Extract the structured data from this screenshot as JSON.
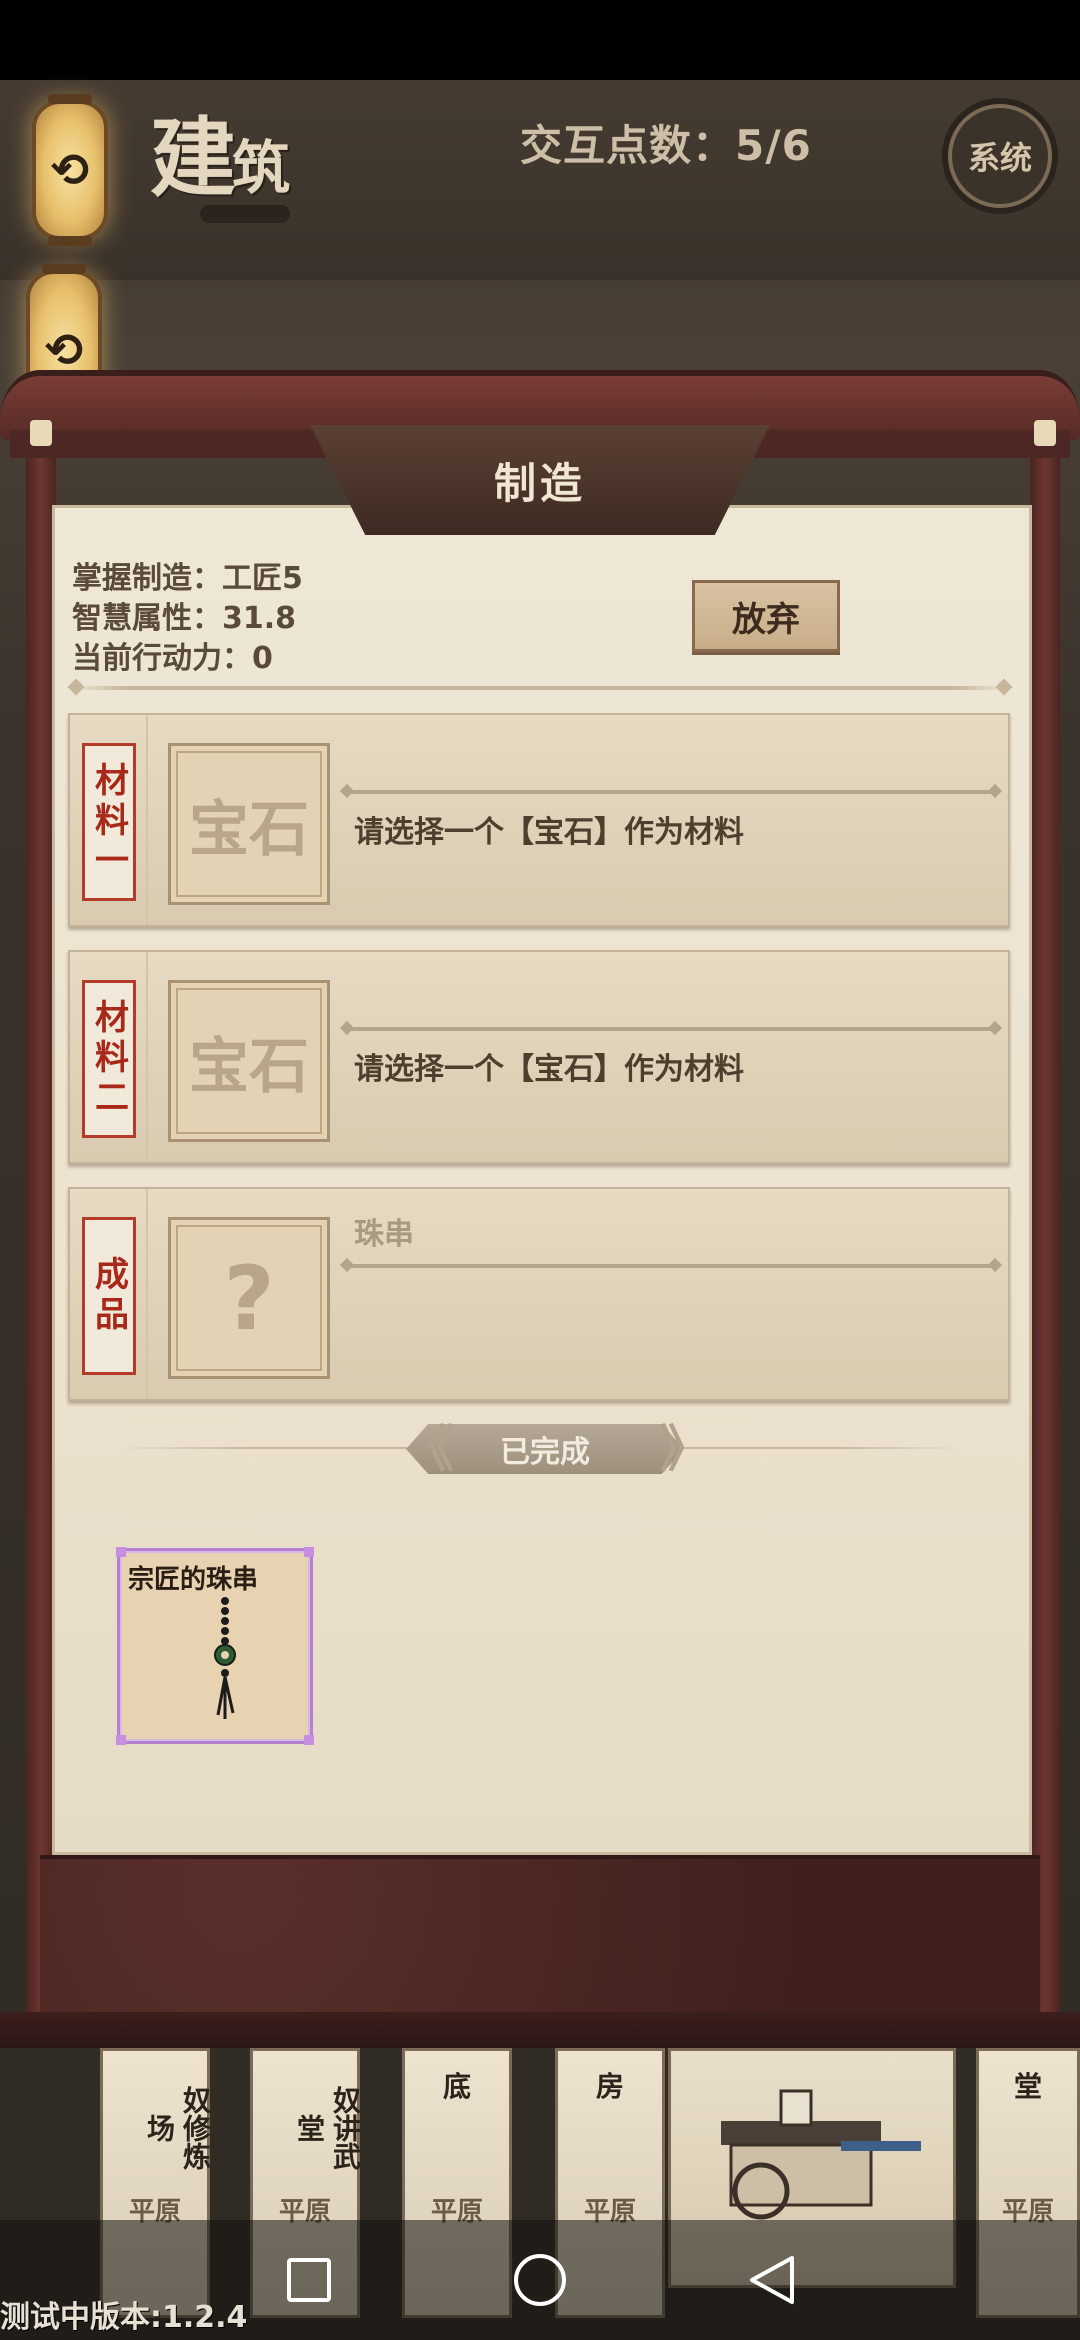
{
  "header": {
    "title_char1": "建",
    "title_char2": "筑",
    "interaction_points": "交互点数：5/6",
    "system_label": "系统"
  },
  "panel": {
    "title": "制造",
    "info": {
      "mastery": "掌握制造：工匠5",
      "wisdom": "智慧属性：31.8",
      "action_points": "当前行动力：0"
    },
    "abandon_label": "放弃",
    "slots": [
      {
        "tag": "材料一",
        "placeholder": "宝石",
        "prompt": "请选择一个【宝石】作为材料"
      },
      {
        "tag": "材料二",
        "placeholder": "宝石",
        "prompt": "请选择一个【宝石】作为材料"
      },
      {
        "tag": "成品",
        "placeholder": "?",
        "name": "珠串"
      }
    ],
    "completed_label": "已完成",
    "completed_items": [
      {
        "name": "宗匠的珠串",
        "icon": "bead-string-icon",
        "rarity_color": "#b77fd0"
      }
    ]
  },
  "board": {
    "buildings": [
      {
        "name": "奴修炼场",
        "terrain": "平原"
      },
      {
        "name": "奴讲武堂",
        "terrain": "平原"
      },
      {
        "name": "底",
        "terrain": "平原"
      },
      {
        "name": "房",
        "terrain": "平原"
      },
      {
        "name": "堂",
        "terrain": "平原"
      }
    ]
  },
  "nav": {
    "icons": [
      "recent-apps-icon",
      "home-icon",
      "back-icon"
    ]
  },
  "version": "测试中版本:1.2.4",
  "colors": {
    "accent_red": "#b63a2a",
    "frame_maroon": "#5a2c28",
    "parchment": "#efe7d6"
  }
}
